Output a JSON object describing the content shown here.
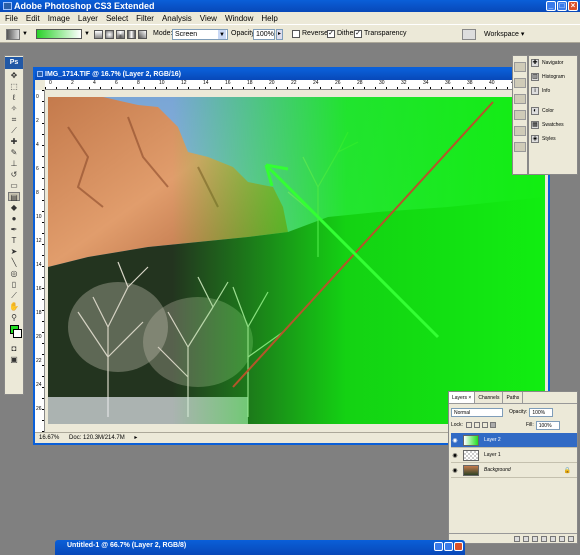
{
  "app": {
    "title": "Adobe Photoshop CS3 Extended",
    "logo_text": "Ps",
    "window_buttons": [
      "_",
      "□",
      "×"
    ]
  },
  "menu": {
    "items": [
      "File",
      "Edit",
      "Image",
      "Layer",
      "Select",
      "Filter",
      "Analysis",
      "View",
      "Window",
      "Help"
    ]
  },
  "options": {
    "mode_label": "Mode:",
    "mode_value": "Screen",
    "opacity_label": "Opacity:",
    "opacity_value": "100%",
    "reverse_label": "Reverse",
    "dither_label": "Dither",
    "transparency_label": "Transparency",
    "workspace_label": "Workspace ▾",
    "reverse_checked": false,
    "dither_checked": true,
    "transparency_checked": true
  },
  "document": {
    "title": "IMG_1714.TIF @ 16.7% (Layer 2, RGB/16)",
    "zoom": "16.67%",
    "doc_size": "Doc: 120.3M/214.7M",
    "ruler_h": [
      "0",
      "2",
      "4",
      "6",
      "8",
      "10",
      "12",
      "14",
      "16",
      "18",
      "20",
      "22",
      "24",
      "26",
      "28",
      "30",
      "32",
      "34",
      "36",
      "38",
      "40",
      "42"
    ],
    "ruler_v": [
      "0",
      "2",
      "4",
      "6",
      "8",
      "10",
      "12",
      "14",
      "16",
      "18",
      "20",
      "22",
      "24",
      "26"
    ]
  },
  "palettes": {
    "group1": [
      {
        "label": "Navigator",
        "icon": "navigator-icon"
      },
      {
        "label": "Histogram",
        "icon": "histogram-icon"
      },
      {
        "label": "Info",
        "icon": "info-icon"
      }
    ],
    "group2": [
      {
        "label": "Color",
        "icon": "color-icon"
      },
      {
        "label": "Swatches",
        "icon": "swatches-icon"
      },
      {
        "label": "Styles",
        "icon": "styles-icon"
      }
    ]
  },
  "layers_panel": {
    "tabs": [
      "Layers ×",
      "Channels",
      "Paths"
    ],
    "blend_mode": "Normal",
    "opacity_label": "Opacity:",
    "opacity_value": "100%",
    "lock_label": "Lock:",
    "fill_label": "Fill:",
    "fill_value": "100%",
    "layers": [
      {
        "name": "Layer 2",
        "selected": true
      },
      {
        "name": "Layer 1",
        "selected": false
      },
      {
        "name": "Background",
        "selected": false
      }
    ]
  },
  "second_document": {
    "title": "Untitled-1 @ 66.7% (Layer 2, RGB/8)"
  },
  "colors": {
    "foreground": "#22dd22",
    "background": "#ffffff",
    "accent": "#0a5fd8"
  }
}
